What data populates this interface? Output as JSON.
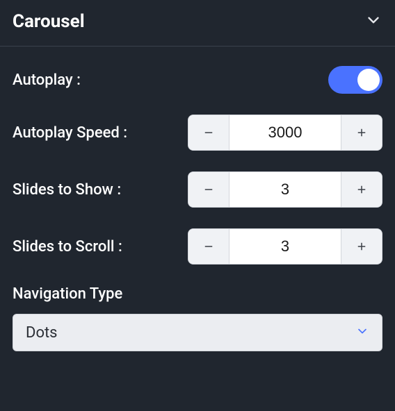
{
  "panel": {
    "title": "Carousel"
  },
  "settings": {
    "autoplay": {
      "label": "Autoplay :",
      "on": true
    },
    "autoplay_speed": {
      "label": "Autoplay Speed :",
      "value": "3000"
    },
    "slides_to_show": {
      "label": "Slides to Show :",
      "value": "3"
    },
    "slides_to_scroll": {
      "label": "Slides to Scroll :",
      "value": "3"
    },
    "navigation_type": {
      "label": "Navigation Type",
      "value": "Dots"
    }
  }
}
